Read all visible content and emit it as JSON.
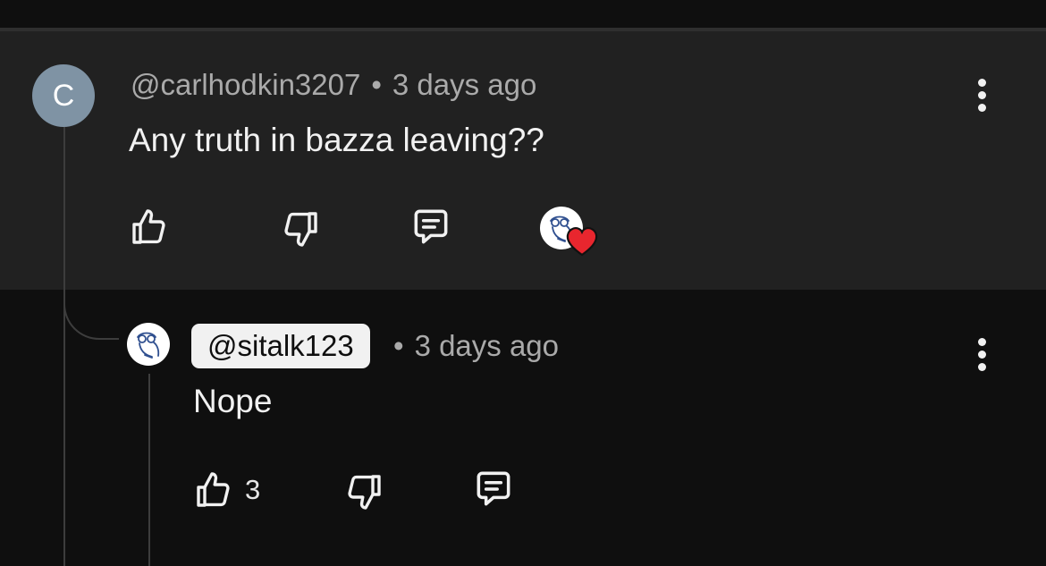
{
  "comment": {
    "avatar_letter": "C",
    "author": "@carlhodkin3207",
    "separator": "•",
    "time": "3 days ago",
    "text": "Any truth in bazza leaving??",
    "creator_heart": true,
    "icons": [
      "thumbs-up-icon",
      "thumbs-down-icon",
      "reply-icon",
      "creator-heart-icon",
      "more-options-icon"
    ]
  },
  "reply": {
    "author": "@sitalk123",
    "separator": "•",
    "time": "3 days ago",
    "text": "Nope",
    "like_count": "3",
    "icons": [
      "thumbs-up-icon",
      "thumbs-down-icon",
      "reply-icon",
      "more-options-icon"
    ]
  },
  "colors": {
    "background": "#0f0f0f",
    "highlighted_comment": "#212121",
    "muted_text": "#aaaaaa",
    "heart": "#e8262e",
    "avatar": "#7f93a4"
  }
}
